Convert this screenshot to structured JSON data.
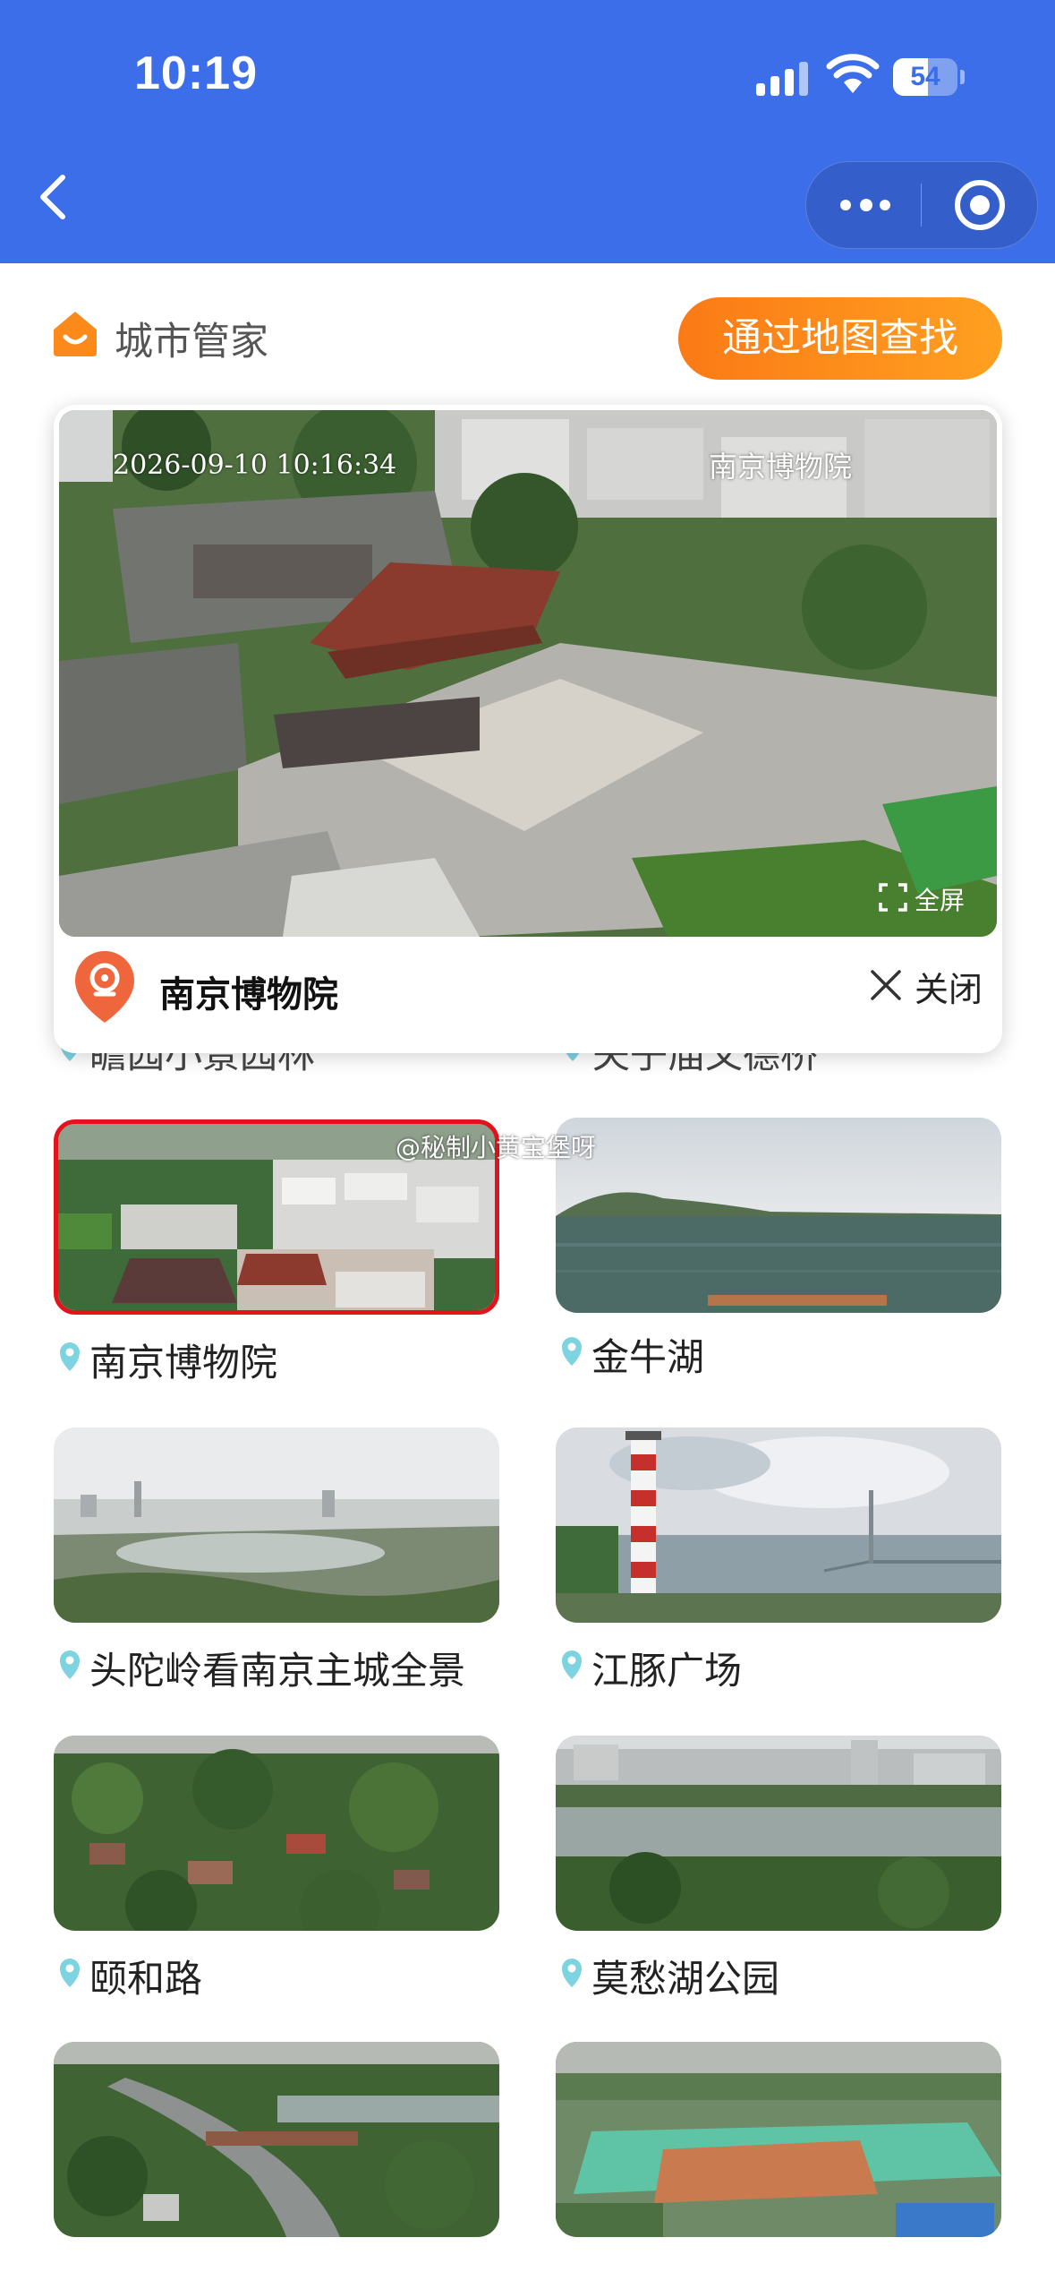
{
  "status_bar": {
    "time": "10:19",
    "battery_level": "54",
    "battery_fraction": 0.54
  },
  "header": {
    "brand_label": "城市管家",
    "map_search_button": "通过地图查找"
  },
  "popup": {
    "osd_timestamp": "2026-09-10 10:16:34",
    "osd_location": "南京博物院",
    "fullscreen_label": "全屏",
    "title": "南京博物院",
    "close_label": "关闭"
  },
  "grid": {
    "hidden_row": [
      "瞻园小景园林",
      "夫子庙文德桥"
    ],
    "items": [
      {
        "label": "南京博物院",
        "selected": true
      },
      {
        "label": "金牛湖",
        "selected": false
      },
      {
        "label": "头陀岭看南京主城全景",
        "selected": false
      },
      {
        "label": "江豚广场",
        "selected": false
      },
      {
        "label": "颐和路",
        "selected": false
      },
      {
        "label": "莫愁湖公园",
        "selected": false
      },
      {
        "label": "",
        "selected": false
      },
      {
        "label": "",
        "selected": false
      }
    ]
  },
  "watermark": "@秘制小黄宝堡呀",
  "colors": {
    "top_bar": "#3c6ee9",
    "accent_orange": "#fb8a1a",
    "selected_border": "#e3131b"
  },
  "icons": [
    "signal-icon",
    "wifi-icon",
    "battery-icon",
    "back-arrow-icon",
    "more-dots-icon",
    "target-close-icon",
    "home-brand-icon",
    "fullscreen-icon",
    "camera-pin-icon",
    "close-x-icon",
    "location-pin-icon"
  ]
}
